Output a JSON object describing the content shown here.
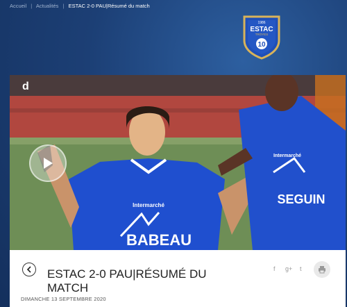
{
  "breadcrumb": {
    "items": [
      "Accueil",
      "Actualités"
    ],
    "current": "ESTAC 2-0 PAU|Résumé du match"
  },
  "logo": {
    "year": "1986",
    "name": "ESTAC",
    "city": "TROYES",
    "number": "10"
  },
  "video": {
    "brand_mark": "d",
    "jersey_sponsor_1": "BABEAU",
    "jersey_sponsor_2": "SEGUIN",
    "jersey_brand": "Intermarché"
  },
  "article": {
    "title": "ESTAC 2-0 PAU|RÉSUMÉ DU MATCH",
    "date": "DIMANCHE 13 SEPTEMBRE 2020"
  },
  "share": {
    "facebook": "f",
    "google": "g+",
    "twitter": "t"
  },
  "colors": {
    "club_blue": "#1c4fbf",
    "accent_gold": "#d8b35a"
  }
}
